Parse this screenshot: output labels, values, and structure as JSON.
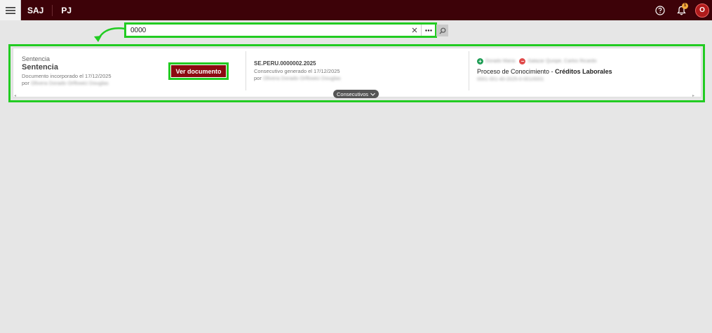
{
  "header": {
    "brand": "SAJ",
    "module": "PJ",
    "notification_count": "1",
    "avatar_initial": "O"
  },
  "search": {
    "value": "0000"
  },
  "result": {
    "document_type": "Sentencia",
    "document_title": "Sentencia",
    "document_incorporated": "Documento incorporado el 17/12/2025",
    "document_by_prefix": "por",
    "document_by_name": "Olivera Dorado Orlfowici Douglas",
    "view_button_label": "Ver documento",
    "consecutive_code": "SE.PERU.0000002.2025",
    "consecutive_generated": "Consecutivo generado el 17/12/2025",
    "consecutive_by_prefix": "por",
    "consecutive_by_name": "Olivera Dorado Orlfowici Douglas",
    "party_active": "Dorado Maria",
    "party_passive": "Salazar Quispe, Carlos Ricardo",
    "process_type": "Proceso de Conocimiento",
    "process_separator": " - ",
    "process_subject": "Créditos Laborales",
    "process_number": "0001-001-40-2025-0-001/0001",
    "consecutivos_label": "Consecutivos"
  },
  "colors": {
    "topbar": "#3d0208",
    "primary_button": "#8c0a12",
    "highlight": "#22cc22"
  }
}
